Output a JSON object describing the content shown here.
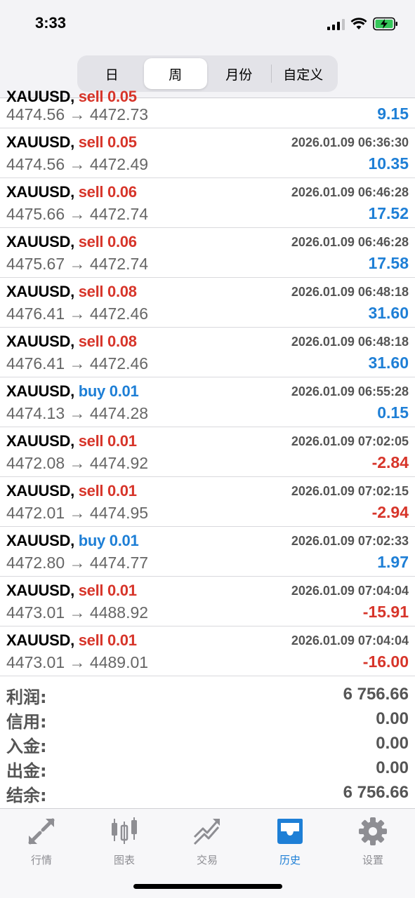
{
  "status_bar": {
    "time": "3:33"
  },
  "header": {
    "tabs": [
      {
        "label": "日"
      },
      {
        "label": "周"
      },
      {
        "label": "月份"
      },
      {
        "label": "自定义"
      }
    ],
    "active_tab": "周"
  },
  "deals": [
    {
      "symbol": "XAUUSD,",
      "side": "sell",
      "volume": "sell 0.05",
      "datetime": "",
      "prices": "4474.56 → 4472.73",
      "profit": "9.15"
    },
    {
      "symbol": "XAUUSD,",
      "side": "sell",
      "volume": "sell 0.05",
      "datetime": "2026.01.09 06:36:30",
      "prices": "4474.56 → 4472.49",
      "profit": "10.35"
    },
    {
      "symbol": "XAUUSD,",
      "side": "sell",
      "volume": "sell 0.06",
      "datetime": "2026.01.09 06:46:28",
      "prices": "4475.66 → 4472.74",
      "profit": "17.52"
    },
    {
      "symbol": "XAUUSD,",
      "side": "sell",
      "volume": "sell 0.06",
      "datetime": "2026.01.09 06:46:28",
      "prices": "4475.67 → 4472.74",
      "profit": "17.58"
    },
    {
      "symbol": "XAUUSD,",
      "side": "sell",
      "volume": "sell 0.08",
      "datetime": "2026.01.09 06:48:18",
      "prices": "4476.41 → 4472.46",
      "profit": "31.60"
    },
    {
      "symbol": "XAUUSD,",
      "side": "sell",
      "volume": "sell 0.08",
      "datetime": "2026.01.09 06:48:18",
      "prices": "4476.41 → 4472.46",
      "profit": "31.60"
    },
    {
      "symbol": "XAUUSD,",
      "side": "buy",
      "volume": "buy 0.01",
      "datetime": "2026.01.09 06:55:28",
      "prices": "4474.13 → 4474.28",
      "profit": "0.15"
    },
    {
      "symbol": "XAUUSD,",
      "side": "sell",
      "volume": "sell 0.01",
      "datetime": "2026.01.09 07:02:05",
      "prices": "4472.08 → 4474.92",
      "profit": "-2.84"
    },
    {
      "symbol": "XAUUSD,",
      "side": "sell",
      "volume": "sell 0.01",
      "datetime": "2026.01.09 07:02:15",
      "prices": "4472.01 → 4474.95",
      "profit": "-2.94"
    },
    {
      "symbol": "XAUUSD,",
      "side": "buy",
      "volume": "buy 0.01",
      "datetime": "2026.01.09 07:02:33",
      "prices": "4472.80 → 4474.77",
      "profit": "1.97"
    },
    {
      "symbol": "XAUUSD,",
      "side": "sell",
      "volume": "sell 0.01",
      "datetime": "2026.01.09 07:04:04",
      "prices": "4473.01 → 4488.92",
      "profit": "-15.91"
    },
    {
      "symbol": "XAUUSD,",
      "side": "sell",
      "volume": "sell 0.01",
      "datetime": "2026.01.09 07:04:04",
      "prices": "4473.01 → 4489.01",
      "profit": "-16.00"
    }
  ],
  "summary": [
    {
      "label": "利润:",
      "value": "6 756.66"
    },
    {
      "label": "信用:",
      "value": "0.00"
    },
    {
      "label": "入金:",
      "value": "0.00"
    },
    {
      "label": "出金:",
      "value": "0.00"
    },
    {
      "label": "结余:",
      "value": "6 756.66"
    }
  ],
  "tabbar": {
    "items": [
      {
        "label": "行情",
        "icon": "quotes-arrows-icon"
      },
      {
        "label": "图表",
        "icon": "candlestick-chart-icon"
      },
      {
        "label": "交易",
        "icon": "trade-trend-icon"
      },
      {
        "label": "历史",
        "icon": "history-inbox-icon"
      },
      {
        "label": "设置",
        "icon": "gear-icon"
      }
    ],
    "active": "历史"
  },
  "colors": {
    "sell": "#d7352a",
    "buy": "#1e7fd6",
    "positive": "#1e7fd6",
    "negative": "#d7352a",
    "active_tab": "#1e7fd6",
    "inactive_tab": "#8e8e93"
  }
}
